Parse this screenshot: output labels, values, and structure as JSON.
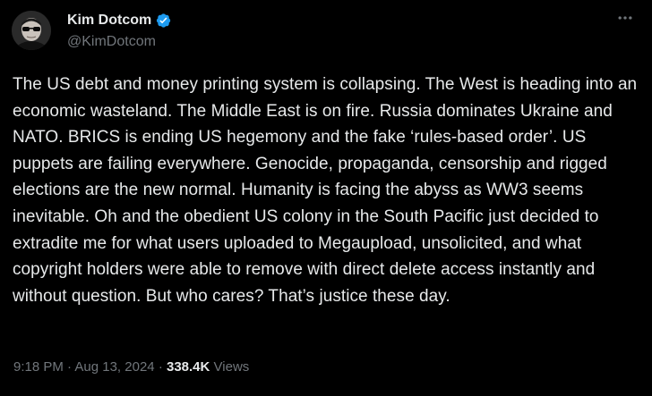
{
  "author": {
    "display_name": "Kim Dotcom",
    "handle": "@KimDotcom",
    "verified_color": "#1d9bf0"
  },
  "tweet": {
    "text": "The US debt and money printing system is collapsing. The West is heading into an economic wasteland. The Middle East is on fire. Russia dominates Ukraine and NATO. BRICS is ending US hegemony and the fake ‘rules-based order’. US puppets are failing everywhere. Genocide, propaganda, censorship and rigged elections are the new normal. Humanity is facing the abyss as WW3 seems inevitable. Oh and the obedient US colony in the South Pacific just decided to extradite me for what users uploaded to Megaupload, unsolicited, and what copyright holders were able to remove with direct delete access instantly and without question. But who cares? That’s justice these day.",
    "time": "9:18 PM",
    "separator": "·",
    "date": "Aug 13, 2024",
    "views_count": "338.4K",
    "views_label": "Views"
  },
  "icons": {
    "verified": "verified-badge-icon",
    "more": "more-options-icon"
  }
}
